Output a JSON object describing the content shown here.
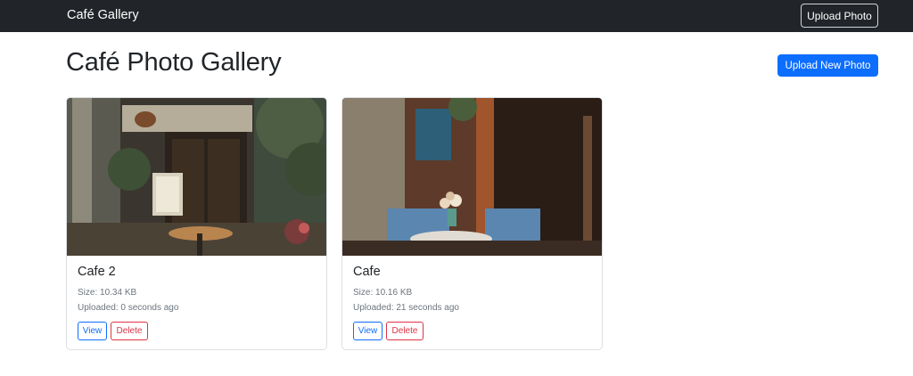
{
  "navbar": {
    "brand": "Café Gallery",
    "upload_label": "Upload Photo"
  },
  "main": {
    "title": "Café Photo Gallery",
    "upload_new_label": "Upload New Photo"
  },
  "photos": [
    {
      "title": "Cafe 2",
      "size": "Size: 10.34 KB",
      "uploaded": "Uploaded: 0 seconds ago",
      "view_label": "View",
      "delete_label": "Delete"
    },
    {
      "title": "Cafe",
      "size": "Size: 10.16 KB",
      "uploaded": "Uploaded: 21 seconds ago",
      "view_label": "View",
      "delete_label": "Delete"
    }
  ],
  "colors": {
    "navbar_bg": "#212529",
    "primary": "#0d6efd",
    "danger": "#dc3545",
    "muted_text": "#6c757d"
  }
}
